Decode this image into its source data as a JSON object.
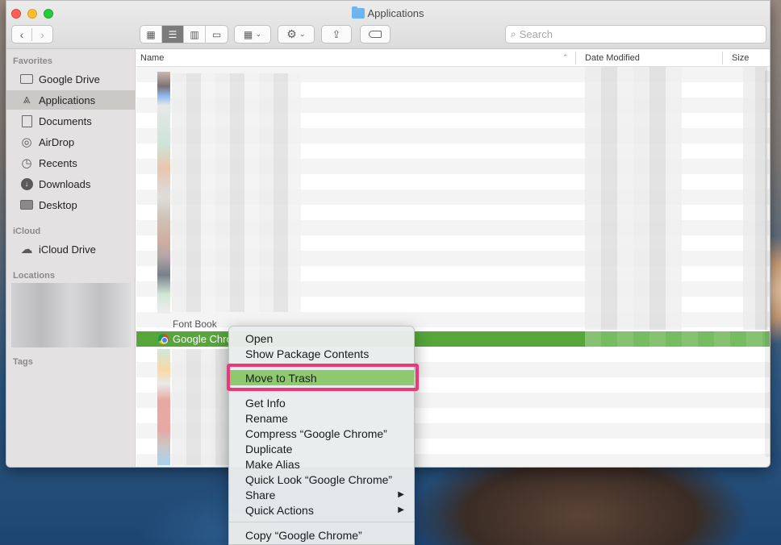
{
  "window": {
    "title": "Applications"
  },
  "toolbar": {
    "view_icons": [
      "icon-view-icon",
      "list-view-icon",
      "column-view-icon",
      "gallery-view-icon"
    ],
    "search_placeholder": "Search"
  },
  "sidebar": {
    "favorites_header": "Favorites",
    "favorites": [
      {
        "label": "Google Drive",
        "icon": "folder-icon"
      },
      {
        "label": "Applications",
        "icon": "applications-icon"
      },
      {
        "label": "Documents",
        "icon": "document-icon"
      },
      {
        "label": "AirDrop",
        "icon": "airdrop-icon"
      },
      {
        "label": "Recents",
        "icon": "clock-icon"
      },
      {
        "label": "Downloads",
        "icon": "download-icon"
      },
      {
        "label": "Desktop",
        "icon": "desktop-icon"
      }
    ],
    "icloud_header": "iCloud",
    "icloud": [
      {
        "label": "iCloud Drive",
        "icon": "cloud-icon"
      }
    ],
    "locations_header": "Locations",
    "tags_header": "Tags"
  },
  "columns": {
    "name": "Name",
    "date_modified": "Date Modified",
    "size": "Size"
  },
  "rows": {
    "partial_label": "Font Book",
    "selected_label": "Google Chro"
  },
  "context_menu": {
    "items": [
      "Open",
      "Show Package Contents",
      "Move to Trash",
      "Get Info",
      "Rename",
      "Compress “Google Chrome”",
      "Duplicate",
      "Make Alias",
      "Quick Look “Google Chrome”",
      "Share",
      "Quick Actions",
      "Copy “Google Chrome”"
    ]
  },
  "colors": {
    "selection_green": "#56a63b",
    "trash_highlight": "#8ec96f",
    "annotation_pink": "#ee3778"
  }
}
